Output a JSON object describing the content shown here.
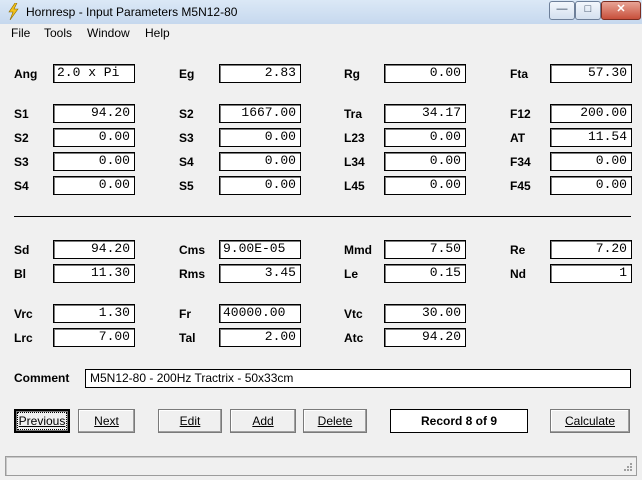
{
  "window": {
    "title": "Hornresp - Input Parameters   M5N12-80",
    "minimize_glyph": "—",
    "maximize_glyph": "□",
    "close_glyph": "✕"
  },
  "menu": {
    "items": [
      "File",
      "Tools",
      "Window",
      "Help"
    ]
  },
  "params": {
    "ang": {
      "label": "Ang",
      "value": "2.0 x Pi"
    },
    "eg": {
      "label": "Eg",
      "value": "2.83"
    },
    "rg": {
      "label": "Rg",
      "value": "0.00"
    },
    "fta": {
      "label": "Fta",
      "value": "57.30"
    },
    "s1": {
      "label": "S1",
      "value": "94.20"
    },
    "s2b": {
      "label": "S2",
      "value": "1667.00"
    },
    "tra": {
      "label": "Tra",
      "value": "34.17"
    },
    "f12": {
      "label": "F12",
      "value": "200.00"
    },
    "s2": {
      "label": "S2",
      "value": "0.00"
    },
    "s3b": {
      "label": "S3",
      "value": "0.00"
    },
    "l23": {
      "label": "L23",
      "value": "0.00"
    },
    "at": {
      "label": "AT",
      "value": "11.54"
    },
    "s3": {
      "label": "S3",
      "value": "0.00"
    },
    "s4b": {
      "label": "S4",
      "value": "0.00"
    },
    "l34": {
      "label": "L34",
      "value": "0.00"
    },
    "f34": {
      "label": "F34",
      "value": "0.00"
    },
    "s4": {
      "label": "S4",
      "value": "0.00"
    },
    "s5": {
      "label": "S5",
      "value": "0.00"
    },
    "l45": {
      "label": "L45",
      "value": "0.00"
    },
    "f45": {
      "label": "F45",
      "value": "0.00"
    },
    "sd": {
      "label": "Sd",
      "value": "94.20"
    },
    "cms": {
      "label": "Cms",
      "value": "9.00E-05"
    },
    "mmd": {
      "label": "Mmd",
      "value": "7.50"
    },
    "re": {
      "label": "Re",
      "value": "7.20"
    },
    "bl": {
      "label": "Bl",
      "value": "11.30"
    },
    "rms": {
      "label": "Rms",
      "value": "3.45"
    },
    "le": {
      "label": "Le",
      "value": "0.15"
    },
    "nd": {
      "label": "Nd",
      "value": "1"
    },
    "vrc": {
      "label": "Vrc",
      "value": "1.30"
    },
    "fr": {
      "label": "Fr",
      "value": "40000.00"
    },
    "vtc": {
      "label": "Vtc",
      "value": "30.00"
    },
    "lrc": {
      "label": "Lrc",
      "value": "7.00"
    },
    "tal": {
      "label": "Tal",
      "value": "2.00"
    },
    "atc": {
      "label": "Atc",
      "value": "94.20"
    }
  },
  "comment": {
    "label": "Comment",
    "value": "M5N12-80 - 200Hz Tractrix - 50x33cm"
  },
  "buttons": {
    "previous": "Previous",
    "next": "Next",
    "edit": "Edit",
    "add": "Add",
    "delete": "Delete",
    "calculate": "Calculate"
  },
  "record": "Record 8 of 9"
}
